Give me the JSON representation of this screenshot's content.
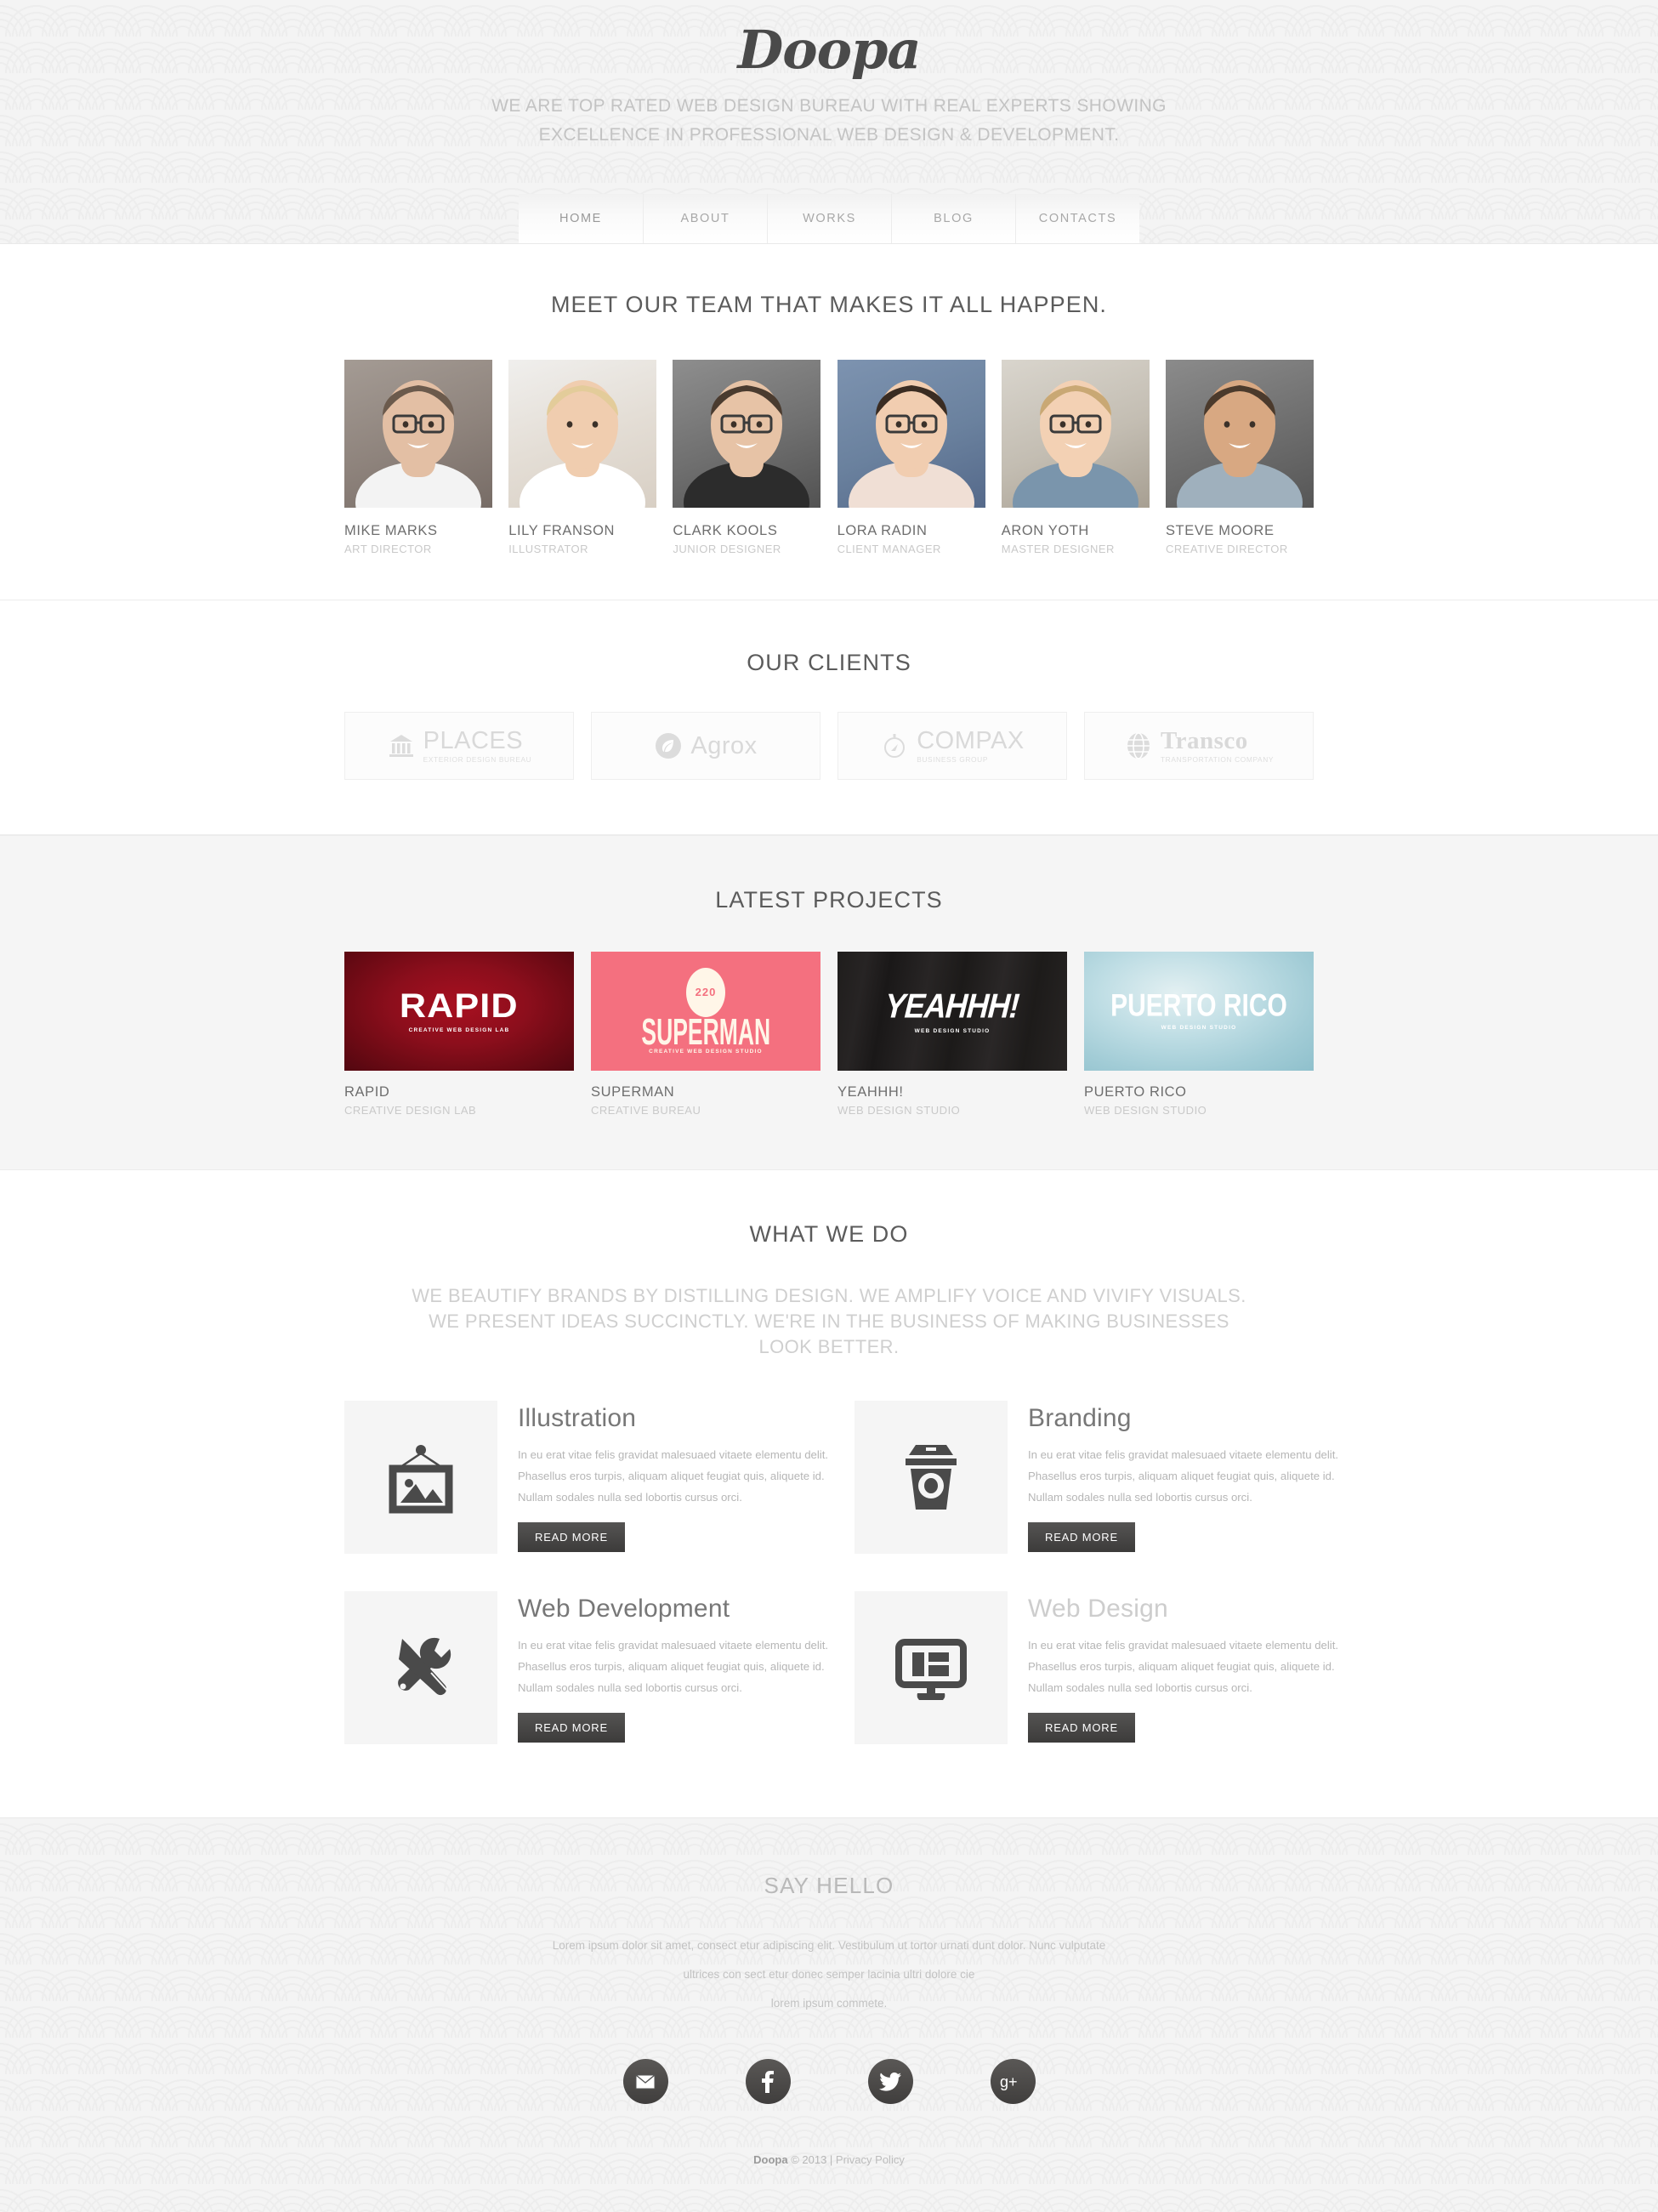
{
  "header": {
    "logo": "Doopa",
    "tagline_line1": "WE ARE TOP RATED WEB DESIGN BUREAU WITH REAL EXPERTS SHOWING",
    "tagline_line2": "EXCELLENCE IN PROFESSIONAL WEB DESIGN & DEVELOPMENT.",
    "nav": [
      {
        "label": "HOME",
        "active": true
      },
      {
        "label": "ABOUT",
        "active": false
      },
      {
        "label": "WORKS",
        "active": false
      },
      {
        "label": "BLOG",
        "active": false
      },
      {
        "label": "CONTACTS",
        "active": false
      }
    ]
  },
  "team": {
    "title": "MEET OUR TEAM THAT MAKES IT ALL HAPPEN.",
    "members": [
      {
        "name": "MIKE MARKS",
        "role": "ART DIRECTOR",
        "photo": "portrait-man-glasses-white-shirt"
      },
      {
        "name": "LILY FRANSON",
        "role": "ILLUSTRATOR",
        "photo": "portrait-blonde-woman-smiling"
      },
      {
        "name": "CLARK KOOLS",
        "role": "JUNIOR DESIGNER",
        "photo": "portrait-man-suit-glasses"
      },
      {
        "name": "LORA RADIN",
        "role": "CLIENT MANAGER",
        "photo": "portrait-woman-dark-hair-glasses"
      },
      {
        "name": "ARON YOTH",
        "role": "MASTER DESIGNER",
        "photo": "portrait-young-man-plaid-glasses"
      },
      {
        "name": "STEVE MOORE",
        "role": "CREATIVE DIRECTOR",
        "photo": "portrait-man-blue-shirt"
      }
    ]
  },
  "clients": {
    "title": "OUR CLIENTS",
    "items": [
      {
        "name": "PLACES",
        "sub": "EXTERIOR DESIGN BUREAU",
        "icon": "bank-columns-icon",
        "style": "sans"
      },
      {
        "name": "Agrox",
        "sub": "",
        "icon": "leaf-circle-icon",
        "style": "sans"
      },
      {
        "name": "COMPAX",
        "sub": "BUSINESS GROUP",
        "icon": "compass-icon",
        "style": "sans"
      },
      {
        "name": "Transco",
        "sub": "TRANSPORTATION COMPANY",
        "icon": "globe-icon",
        "style": "serif"
      }
    ]
  },
  "projects": {
    "title": "LATEST PROJECTS",
    "items": [
      {
        "name": "RAPID",
        "sub": "CREATIVE DESIGN LAB",
        "thumb_title": "RAPID",
        "thumb_sub": "CREATIVE WEB DESIGN LAB",
        "skin": "skin-rapid"
      },
      {
        "name": "SUPERMAN",
        "sub": "CREATIVE BUREAU",
        "thumb_title": "SUPERMAN",
        "thumb_sub": "CREATIVE WEB DESIGN STUDIO",
        "thumb_badge": "220",
        "skin": "skin-superman"
      },
      {
        "name": "YEAHHH!",
        "sub": "WEB DESIGN STUDIO",
        "thumb_title": "YEAHHH!",
        "thumb_sub": "WEB DESIGN STUDIO",
        "skin": "skin-yeahhh"
      },
      {
        "name": "PUERTO RICO",
        "sub": "WEB DESIGN STUDIO",
        "thumb_title": "PUERTO RICO",
        "thumb_sub": "WEB DESIGN STUDIO",
        "skin": "skin-puerto"
      }
    ]
  },
  "what_we_do": {
    "title": "WHAT WE DO",
    "description": "WE BEAUTIFY BRANDS BY DISTILLING DESIGN. WE AMPLIFY VOICE AND VIVIFY VISUALS. WE PRESENT IDEAS SUCCINCTLY. WE'RE IN THE BUSINESS OF MAKING BUSINESSES LOOK BETTER.",
    "body_text": "In eu erat vitae felis gravidat malesuaed vitaete elementu delit. Phasellus eros turpis, aliquam aliquet feugiat quis, aliquete id.  Nullam sodales nulla sed lobortis cursus orci.",
    "read_more_label": "READ MORE",
    "services": [
      {
        "title": "Illustration",
        "icon": "framed-picture-icon",
        "muted": false
      },
      {
        "title": "Branding",
        "icon": "coffee-cup-icon",
        "muted": false
      },
      {
        "title": "Web Development",
        "icon": "wrench-screwdriver-icon",
        "muted": false
      },
      {
        "title": "Web Design",
        "icon": "monitor-layout-icon",
        "muted": true
      }
    ]
  },
  "footer": {
    "title": "SAY HELLO",
    "desc_line1": "Lorem ipsum dolor sit amet, consect etur adipiscing elit. Vestibulum ut tortor urnati dunt dolor. Nunc vulputate",
    "desc_line2": "ultrices con sect etur donec semper lacinia ultri  dolore cie",
    "desc_line3": "lorem ipsum commete.",
    "socials": [
      {
        "name": "email-icon"
      },
      {
        "name": "facebook-icon"
      },
      {
        "name": "twitter-icon"
      },
      {
        "name": "google-plus-icon"
      }
    ],
    "copyright_brand": "Doopa",
    "copyright_rest": " © 2013 | ",
    "privacy_label": "Privacy Policy"
  },
  "colors": {
    "accent_dark": "#403e3d",
    "project_red": "#8c0e1c",
    "project_pink": "#f4707f",
    "project_black": "#1f1d1c",
    "project_blue": "#a2ccd6",
    "section_gray": "#f5f5f5"
  }
}
